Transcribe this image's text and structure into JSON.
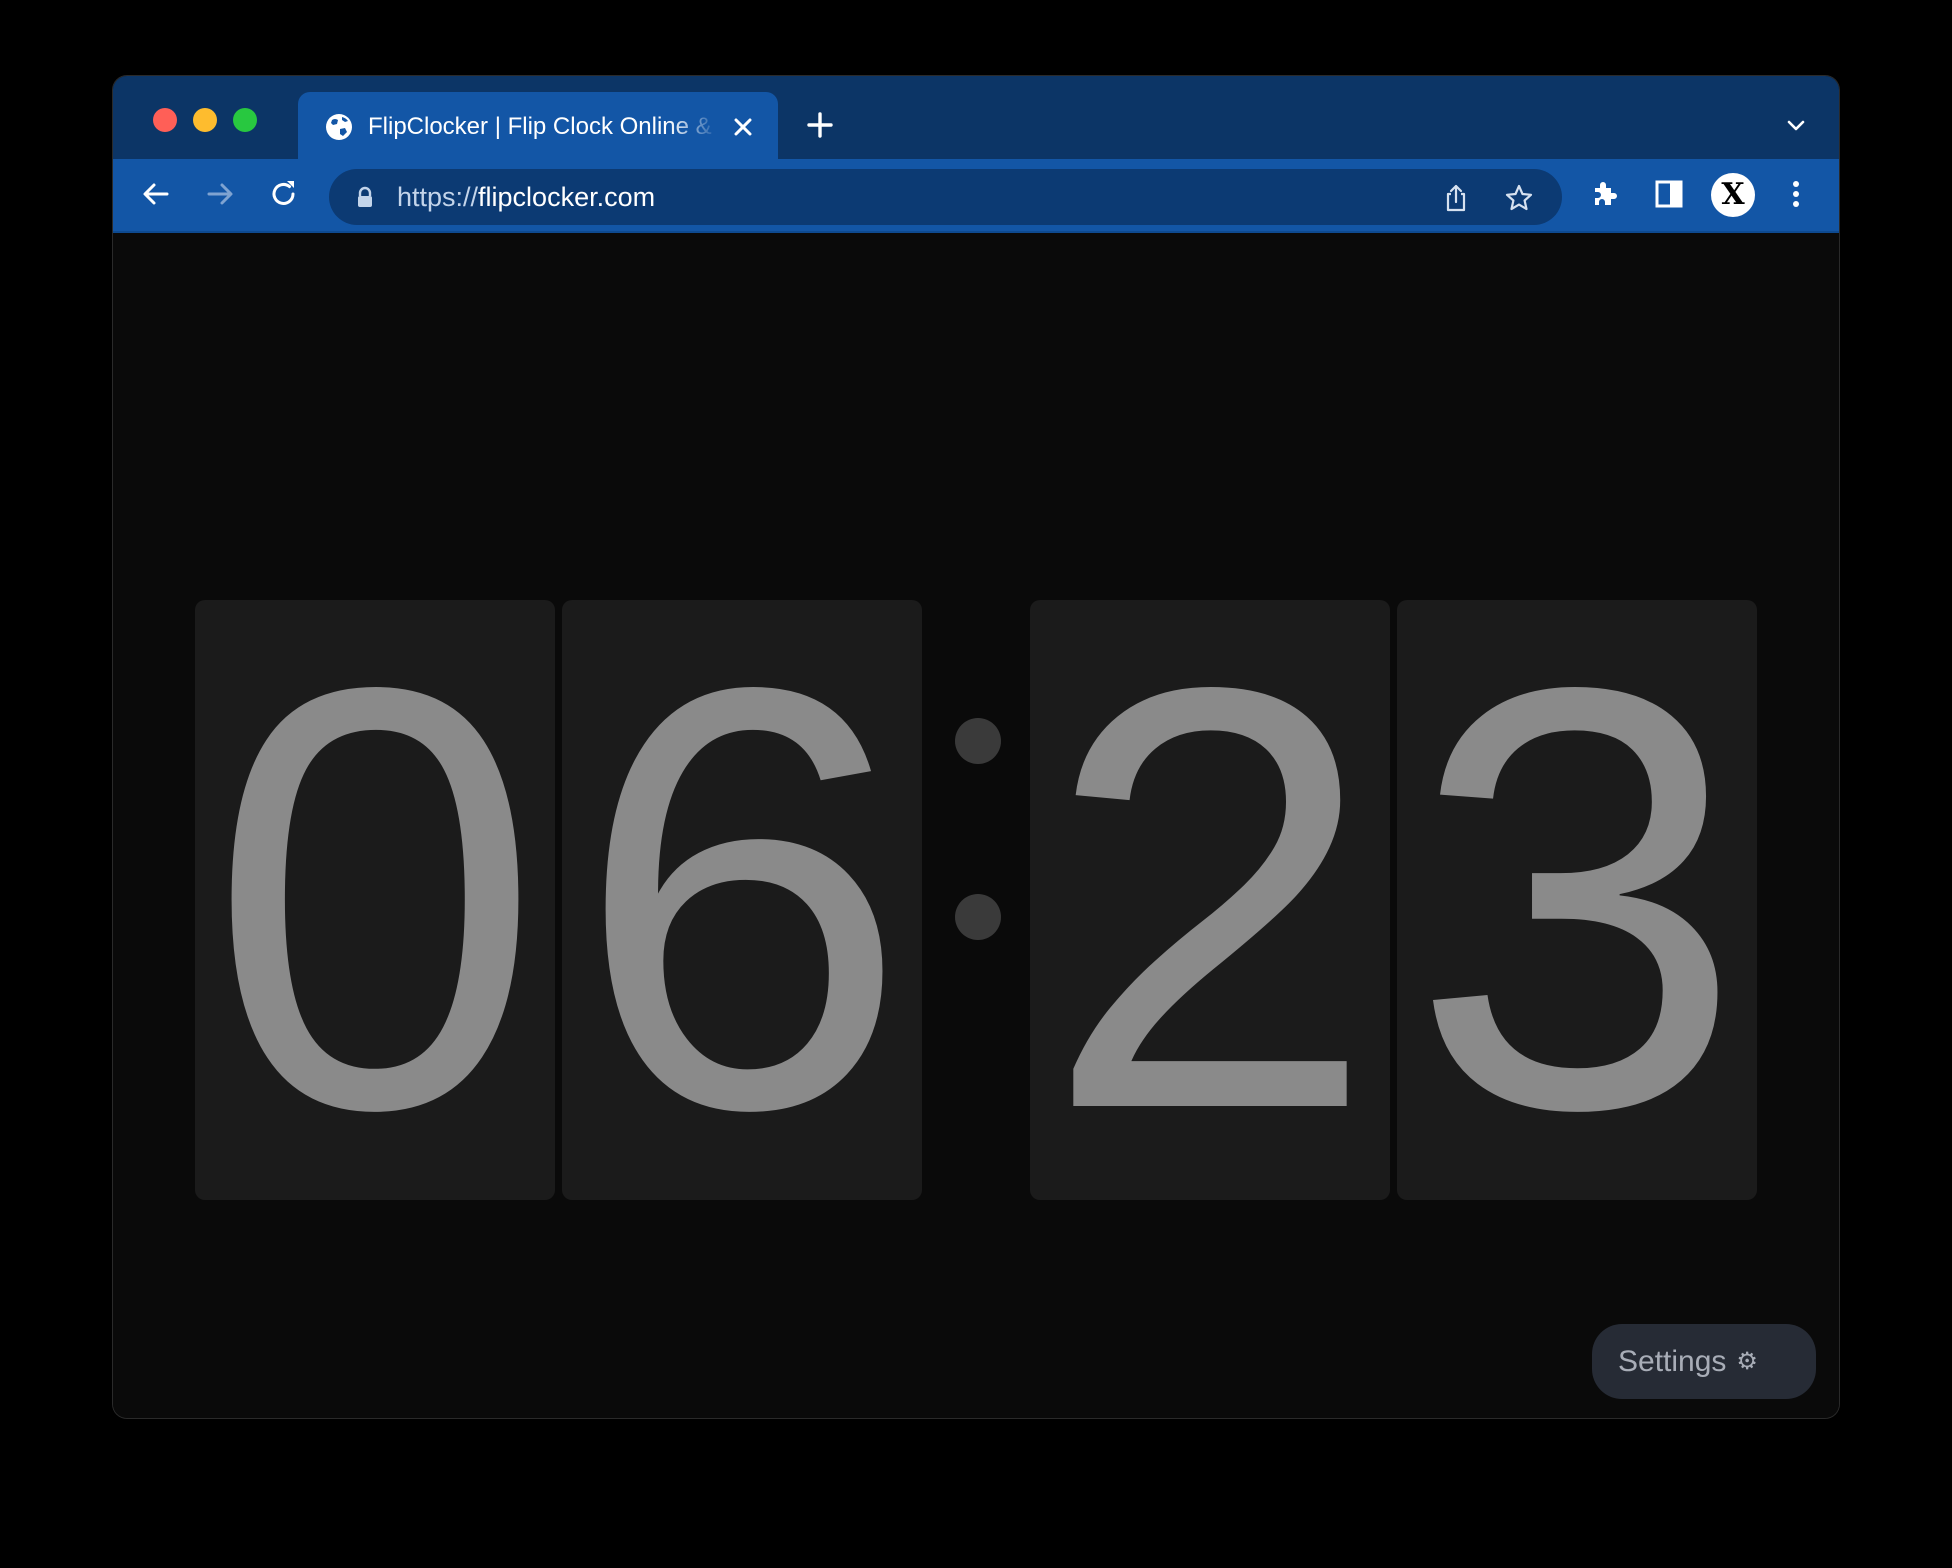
{
  "browser": {
    "tab": {
      "title": "FlipClocker | Flip Clock Online & Timer",
      "favicon": "globe-icon"
    },
    "address": {
      "scheme": "https://",
      "host": "flipclocker.com"
    },
    "toolbar_icons": [
      "back-icon",
      "forward-icon",
      "reload-icon",
      "lock-icon",
      "share-icon",
      "star-icon",
      "extensions-icon",
      "side-panel-icon",
      "profile-avatar",
      "more-menu-icon"
    ],
    "profile_initial": "X",
    "colors": {
      "tabstrip": "#0c3566",
      "toolbar": "#1356a6",
      "omnibox": "#0c3a73"
    }
  },
  "clock": {
    "time": "06:23",
    "digits": [
      "0",
      "6",
      "2",
      "3"
    ],
    "colors": {
      "background": "#0a0a0a",
      "card": "#1b1b1b",
      "digit": "#8a8a8a",
      "colon": "#3a3a3a"
    }
  },
  "settings": {
    "label": "Settings",
    "icon_glyph": "⚙",
    "icon": "gear-icon"
  }
}
